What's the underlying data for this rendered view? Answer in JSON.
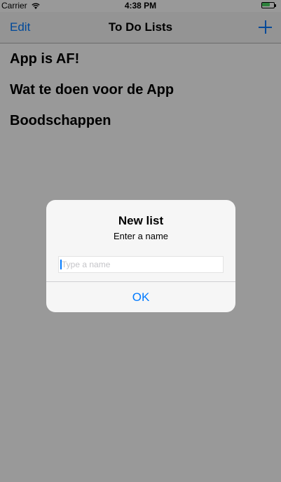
{
  "status_bar": {
    "carrier": "Carrier",
    "time": "4:38 PM",
    "battery_level": 0.7,
    "battery_color": "#4cd964"
  },
  "nav": {
    "edit_label": "Edit",
    "title": "To Do Lists",
    "add_icon": "plus-icon"
  },
  "lists": [
    {
      "name": "App is AF!"
    },
    {
      "name": "Wat te doen voor de App"
    },
    {
      "name": "Boodschappen"
    }
  ],
  "alert": {
    "title": "New list",
    "message": "Enter a name",
    "input_placeholder": "Type a name",
    "input_value": "",
    "ok_label": "OK"
  },
  "colors": {
    "accent": "#007aff",
    "overlay": "rgba(0,0,0,0.4)"
  }
}
